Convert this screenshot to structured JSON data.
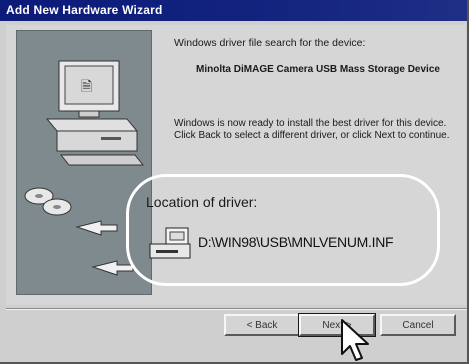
{
  "window": {
    "title": "Add New Hardware Wizard"
  },
  "body": {
    "line1": "Windows driver file search for the device:",
    "device_name": "Minolta DiMAGE Camera USB Mass Storage Device",
    "paragraph": "Windows is now ready to install the best driver for this device. Click Back to select a different driver, or click Next to continue."
  },
  "callout": {
    "location_label": "Location of driver:",
    "driver_path": "D:\\WIN98\\USB\\MNLVENUM.INF"
  },
  "buttons": {
    "back": "< Back",
    "next": "Next >",
    "cancel": "Cancel"
  },
  "colors": {
    "titlebar": "#0c1a7a",
    "dialog_bg": "#d6d6d6",
    "callout_border": "#ffffff"
  },
  "icons": [
    "computer-icon",
    "cd-disc-icon",
    "arrow-icon",
    "drive-icon",
    "mouse-cursor-icon"
  ]
}
